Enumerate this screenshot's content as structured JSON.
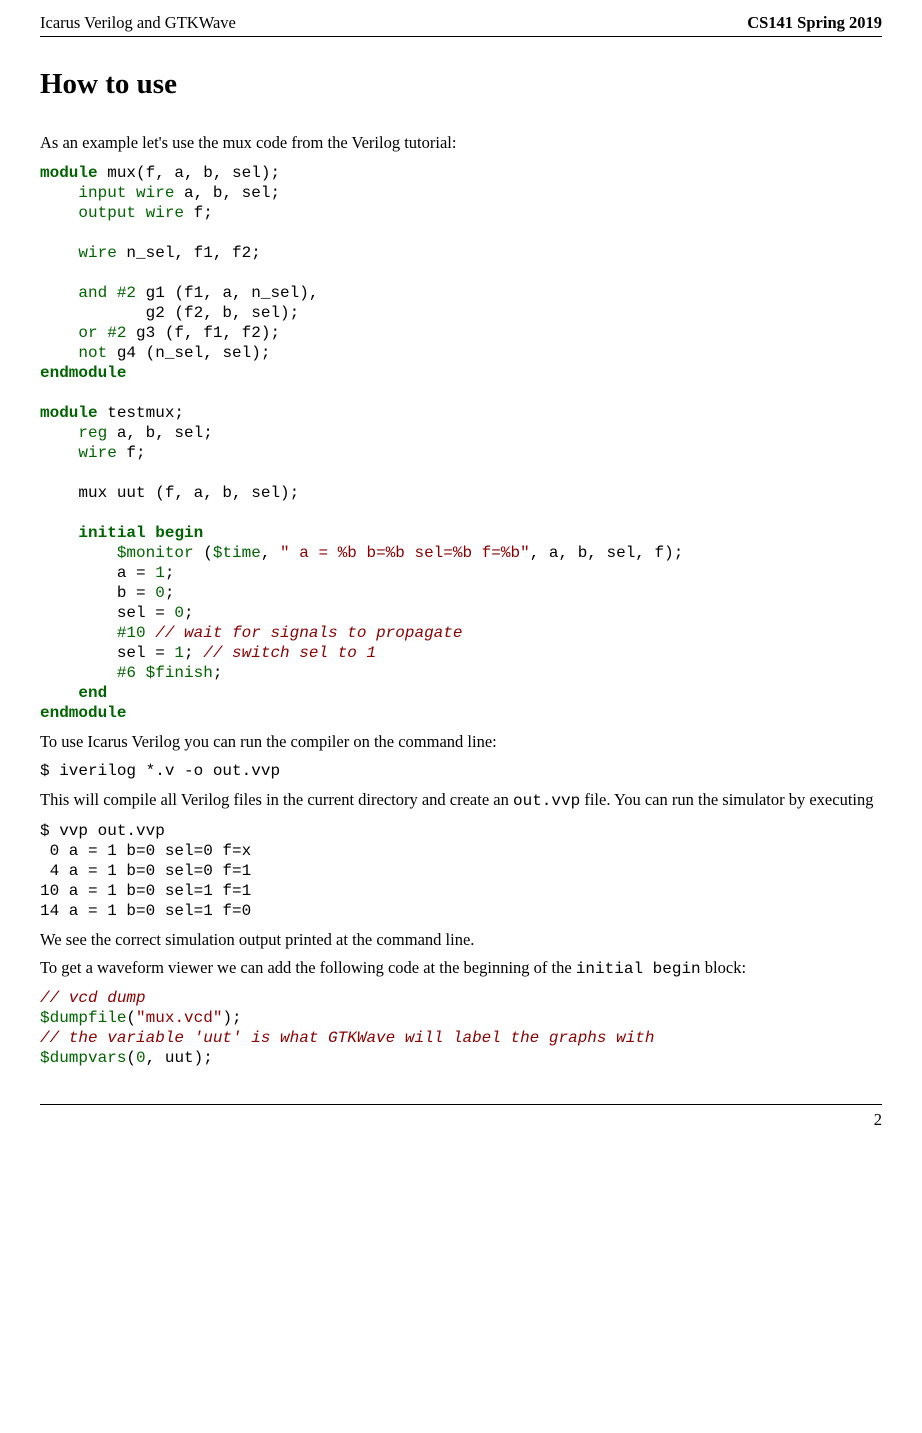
{
  "header": {
    "left": "Icarus Verilog and GTKWave",
    "right": "CS141 Spring 2019"
  },
  "title": "How to use",
  "p1": "As an example let's use the mux code from the Verilog tutorial:",
  "code1": {
    "l1a": "module",
    "l1b": " mux(f, a, b, sel);",
    "l2a": "    ",
    "l2b": "input",
    "l2c": " ",
    "l2d": "wire",
    "l2e": " a, b, sel;",
    "l3a": "    ",
    "l3b": "output",
    "l3c": " ",
    "l3d": "wire",
    "l3e": " f;",
    "l5a": "    ",
    "l5b": "wire",
    "l5c": " n_sel, f1, f2;",
    "l7a": "    ",
    "l7b": "and",
    "l7c": " ",
    "l7d": "#2",
    "l7e": " g1 (f1, a, n_sel),",
    "l8": "           g2 (f2, b, sel);",
    "l9a": "    ",
    "l9b": "or",
    "l9c": " ",
    "l9d": "#2",
    "l9e": " g3 (f, f1, f2);",
    "l10a": "    ",
    "l10b": "not",
    "l10c": " g4 (n_sel, sel);",
    "l11": "endmodule",
    "l13a": "module",
    "l13b": " testmux;",
    "l14a": "    ",
    "l14b": "reg",
    "l14c": " a, b, sel;",
    "l15a": "    ",
    "l15b": "wire",
    "l15c": " f;",
    "l17": "    mux uut (f, a, b, sel);",
    "l19a": "    ",
    "l19b": "initial",
    "l19c": " ",
    "l19d": "begin",
    "l20a": "        ",
    "l20b": "$monitor",
    "l20c": " (",
    "l20d": "$time",
    "l20e": ", ",
    "l20f": "\" a = %b b=%b sel=%b f=%b\"",
    "l20g": ", a, b, sel, f);",
    "l21a": "        a = ",
    "l21b": "1",
    "l21c": ";",
    "l22a": "        b = ",
    "l22b": "0",
    "l22c": ";",
    "l23a": "        sel = ",
    "l23b": "0",
    "l23c": ";",
    "l24a": "        ",
    "l24b": "#10",
    "l24c": " ",
    "l24d": "// wait for signals to propagate",
    "l25a": "        sel = ",
    "l25b": "1",
    "l25c": "; ",
    "l25d": "// switch sel to 1",
    "l26a": "        ",
    "l26b": "#6",
    "l26c": " ",
    "l26d": "$finish",
    "l26e": ";",
    "l27a": "    ",
    "l27b": "end",
    "l28": "endmodule"
  },
  "p2": "To use Icarus Verilog you can run the compiler on the command line:",
  "code2": "$ iverilog *.v -o out.vvp",
  "p3a": "This will compile all Verilog files in the current directory and create an ",
  "p3b": "out.vvp",
  "p3c": " file. You can run the simulator by executing",
  "code3": "$ vvp out.vvp\n 0 a = 1 b=0 sel=0 f=x\n 4 a = 1 b=0 sel=0 f=1\n10 a = 1 b=0 sel=1 f=1\n14 a = 1 b=0 sel=1 f=0",
  "p4": "We see the correct simulation output printed at the command line.",
  "p5a": "To get a waveform viewer we can add the following code at the beginning of the ",
  "p5b": "initial begin",
  "p5c": " block:",
  "code4": {
    "l1": "// vcd dump",
    "l2a": "$dumpfile",
    "l2b": "(",
    "l2c": "\"mux.vcd\"",
    "l2d": ");",
    "l3": "// the variable 'uut' is what GTKWave will label the graphs with",
    "l4a": "$dumpvars",
    "l4b": "(",
    "l4c": "0",
    "l4d": ", uut);"
  },
  "footer": {
    "page": "2"
  }
}
